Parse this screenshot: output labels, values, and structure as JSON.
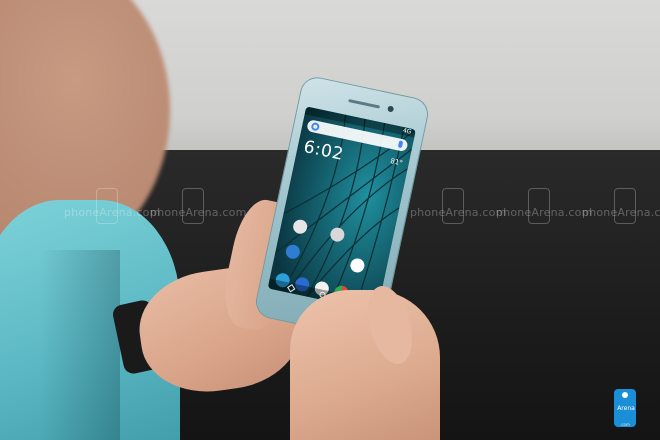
{
  "photo": {
    "subject": "hand-holding-smartphone",
    "screen_time": "6:02",
    "status_right": "4G",
    "weather_temp": "81°",
    "dock_apps": [
      "phone-app",
      "messages-app",
      "app-drawer",
      "chrome-app",
      "camera-app"
    ],
    "row_apps": [
      "maps-app",
      "spacer",
      "play-store-app"
    ],
    "home_apps": [
      "xperia-lounge",
      "settings-app"
    ]
  },
  "watermark": {
    "text": "phoneArena.com",
    "repeat": 7
  },
  "logo": {
    "label": "Arena",
    "sub": ".com",
    "color": "#1a8ed6"
  },
  "colors": {
    "shirt": "#5bb8c4",
    "phone_frame": "#9ec3cc",
    "screen_bg": "#0b3f4a",
    "desk": "#1c1c1c",
    "wall": "#cfcfcd"
  }
}
